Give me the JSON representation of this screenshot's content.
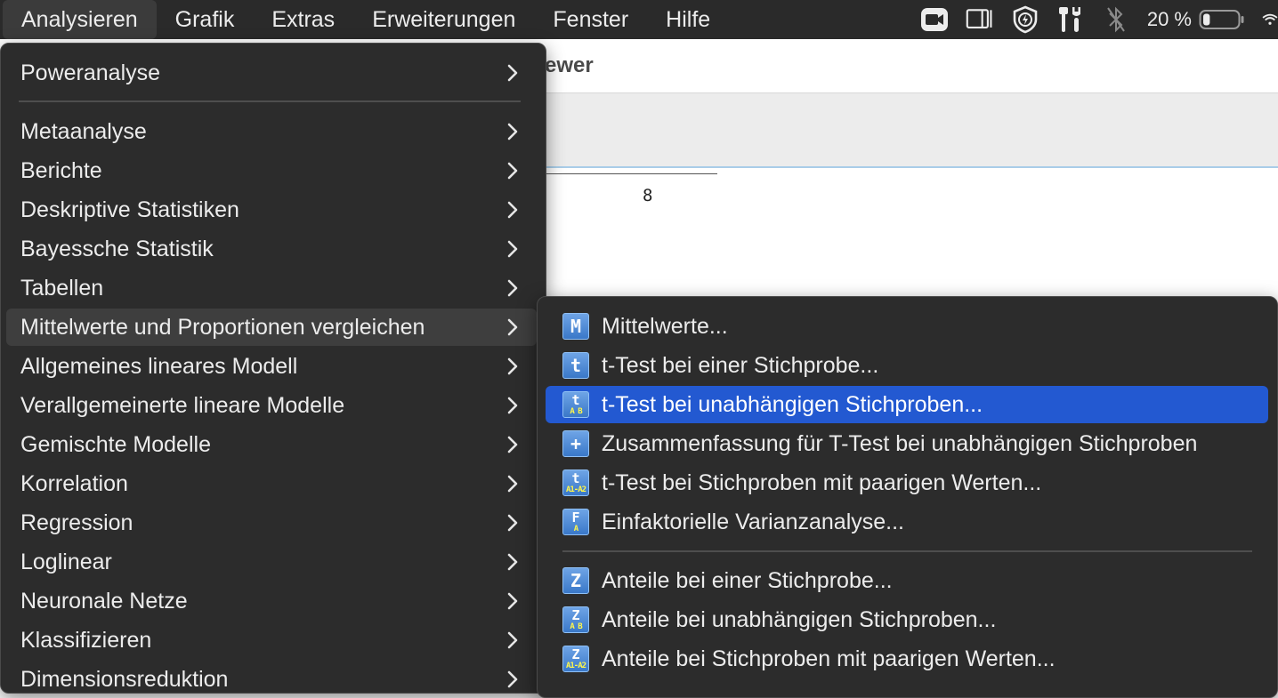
{
  "menubar": {
    "items": [
      "Analysieren",
      "Grafik",
      "Extras",
      "Erweiterungen",
      "Fenster",
      "Hilfe"
    ],
    "active_index": 0,
    "status": {
      "icons": [
        "video-camera-icon",
        "sidebar-window-icon",
        "shield-icon",
        "tools-icon",
        "bluetooth-off-icon",
        "battery-icon",
        "wifi-icon"
      ],
      "battery_text": "20 %",
      "battery_level": 0.2
    }
  },
  "viewer": {
    "title_fragment": "ewer",
    "output_value": "8"
  },
  "main_menu": {
    "items": [
      {
        "label": "Poweranalyse"
      },
      {
        "label": "Metaanalyse"
      },
      {
        "label": "Berichte"
      },
      {
        "label": "Deskriptive Statistiken"
      },
      {
        "label": "Bayessche Statistik"
      },
      {
        "label": "Tabellen"
      },
      {
        "label": "Mittelwerte und Proportionen vergleichen",
        "highlighted": true
      },
      {
        "label": "Allgemeines lineares Modell"
      },
      {
        "label": "Verallgemeinerte lineare Modelle"
      },
      {
        "label": "Gemischte Modelle"
      },
      {
        "label": "Korrelation"
      },
      {
        "label": "Regression"
      },
      {
        "label": "Loglinear"
      },
      {
        "label": "Neuronale Netze"
      },
      {
        "label": "Klassifizieren"
      },
      {
        "label": "Dimensionsreduktion"
      }
    ]
  },
  "sub_menu": {
    "items": [
      {
        "label": "Mittelwerte...",
        "icon": "M"
      },
      {
        "label": "t-Test bei einer Stichprobe...",
        "icon": "t"
      },
      {
        "label": "t-Test bei unabhängigen Stichproben...",
        "icon": "t",
        "icon_sub": "A B",
        "selected": true
      },
      {
        "label": "Zusammenfassung für T-Test bei unabhängigen Stichproben",
        "icon": "+"
      },
      {
        "label": "t-Test bei Stichproben mit paarigen Werten...",
        "icon": "t",
        "icon_sub": "A1-A2"
      },
      {
        "label": "Einfaktorielle Varianzanalyse...",
        "icon": "F",
        "icon_sub": "A"
      },
      {
        "label": "Anteile bei einer Stichprobe...",
        "icon": "Z"
      },
      {
        "label": "Anteile bei unabhängigen Stichproben...",
        "icon": "Z",
        "icon_sub": "A B"
      },
      {
        "label": "Anteile bei Stichproben mit paarigen Werten...",
        "icon": "Z",
        "icon_sub": "A1-A2"
      }
    ]
  }
}
